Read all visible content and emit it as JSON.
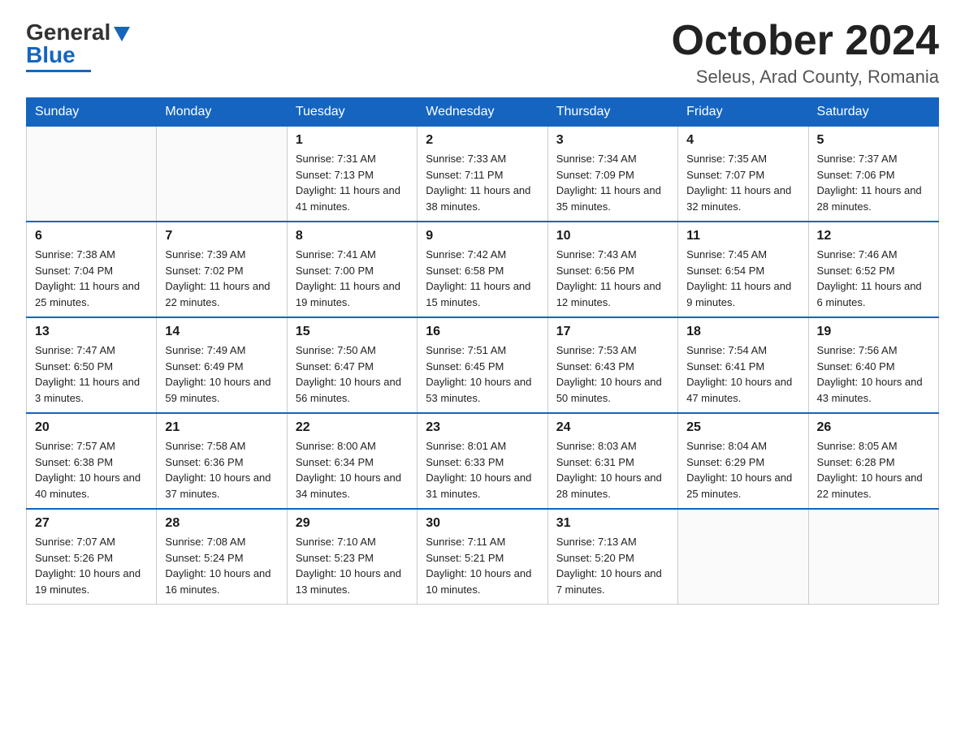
{
  "logo": {
    "general": "General",
    "blue": "Blue"
  },
  "header": {
    "month_title": "October 2024",
    "location": "Seleus, Arad County, Romania"
  },
  "weekdays": [
    "Sunday",
    "Monday",
    "Tuesday",
    "Wednesday",
    "Thursday",
    "Friday",
    "Saturday"
  ],
  "weeks": [
    [
      {
        "day": "",
        "sunrise": "",
        "sunset": "",
        "daylight": ""
      },
      {
        "day": "",
        "sunrise": "",
        "sunset": "",
        "daylight": ""
      },
      {
        "day": "1",
        "sunrise": "Sunrise: 7:31 AM",
        "sunset": "Sunset: 7:13 PM",
        "daylight": "Daylight: 11 hours and 41 minutes."
      },
      {
        "day": "2",
        "sunrise": "Sunrise: 7:33 AM",
        "sunset": "Sunset: 7:11 PM",
        "daylight": "Daylight: 11 hours and 38 minutes."
      },
      {
        "day": "3",
        "sunrise": "Sunrise: 7:34 AM",
        "sunset": "Sunset: 7:09 PM",
        "daylight": "Daylight: 11 hours and 35 minutes."
      },
      {
        "day": "4",
        "sunrise": "Sunrise: 7:35 AM",
        "sunset": "Sunset: 7:07 PM",
        "daylight": "Daylight: 11 hours and 32 minutes."
      },
      {
        "day": "5",
        "sunrise": "Sunrise: 7:37 AM",
        "sunset": "Sunset: 7:06 PM",
        "daylight": "Daylight: 11 hours and 28 minutes."
      }
    ],
    [
      {
        "day": "6",
        "sunrise": "Sunrise: 7:38 AM",
        "sunset": "Sunset: 7:04 PM",
        "daylight": "Daylight: 11 hours and 25 minutes."
      },
      {
        "day": "7",
        "sunrise": "Sunrise: 7:39 AM",
        "sunset": "Sunset: 7:02 PM",
        "daylight": "Daylight: 11 hours and 22 minutes."
      },
      {
        "day": "8",
        "sunrise": "Sunrise: 7:41 AM",
        "sunset": "Sunset: 7:00 PM",
        "daylight": "Daylight: 11 hours and 19 minutes."
      },
      {
        "day": "9",
        "sunrise": "Sunrise: 7:42 AM",
        "sunset": "Sunset: 6:58 PM",
        "daylight": "Daylight: 11 hours and 15 minutes."
      },
      {
        "day": "10",
        "sunrise": "Sunrise: 7:43 AM",
        "sunset": "Sunset: 6:56 PM",
        "daylight": "Daylight: 11 hours and 12 minutes."
      },
      {
        "day": "11",
        "sunrise": "Sunrise: 7:45 AM",
        "sunset": "Sunset: 6:54 PM",
        "daylight": "Daylight: 11 hours and 9 minutes."
      },
      {
        "day": "12",
        "sunrise": "Sunrise: 7:46 AM",
        "sunset": "Sunset: 6:52 PM",
        "daylight": "Daylight: 11 hours and 6 minutes."
      }
    ],
    [
      {
        "day": "13",
        "sunrise": "Sunrise: 7:47 AM",
        "sunset": "Sunset: 6:50 PM",
        "daylight": "Daylight: 11 hours and 3 minutes."
      },
      {
        "day": "14",
        "sunrise": "Sunrise: 7:49 AM",
        "sunset": "Sunset: 6:49 PM",
        "daylight": "Daylight: 10 hours and 59 minutes."
      },
      {
        "day": "15",
        "sunrise": "Sunrise: 7:50 AM",
        "sunset": "Sunset: 6:47 PM",
        "daylight": "Daylight: 10 hours and 56 minutes."
      },
      {
        "day": "16",
        "sunrise": "Sunrise: 7:51 AM",
        "sunset": "Sunset: 6:45 PM",
        "daylight": "Daylight: 10 hours and 53 minutes."
      },
      {
        "day": "17",
        "sunrise": "Sunrise: 7:53 AM",
        "sunset": "Sunset: 6:43 PM",
        "daylight": "Daylight: 10 hours and 50 minutes."
      },
      {
        "day": "18",
        "sunrise": "Sunrise: 7:54 AM",
        "sunset": "Sunset: 6:41 PM",
        "daylight": "Daylight: 10 hours and 47 minutes."
      },
      {
        "day": "19",
        "sunrise": "Sunrise: 7:56 AM",
        "sunset": "Sunset: 6:40 PM",
        "daylight": "Daylight: 10 hours and 43 minutes."
      }
    ],
    [
      {
        "day": "20",
        "sunrise": "Sunrise: 7:57 AM",
        "sunset": "Sunset: 6:38 PM",
        "daylight": "Daylight: 10 hours and 40 minutes."
      },
      {
        "day": "21",
        "sunrise": "Sunrise: 7:58 AM",
        "sunset": "Sunset: 6:36 PM",
        "daylight": "Daylight: 10 hours and 37 minutes."
      },
      {
        "day": "22",
        "sunrise": "Sunrise: 8:00 AM",
        "sunset": "Sunset: 6:34 PM",
        "daylight": "Daylight: 10 hours and 34 minutes."
      },
      {
        "day": "23",
        "sunrise": "Sunrise: 8:01 AM",
        "sunset": "Sunset: 6:33 PM",
        "daylight": "Daylight: 10 hours and 31 minutes."
      },
      {
        "day": "24",
        "sunrise": "Sunrise: 8:03 AM",
        "sunset": "Sunset: 6:31 PM",
        "daylight": "Daylight: 10 hours and 28 minutes."
      },
      {
        "day": "25",
        "sunrise": "Sunrise: 8:04 AM",
        "sunset": "Sunset: 6:29 PM",
        "daylight": "Daylight: 10 hours and 25 minutes."
      },
      {
        "day": "26",
        "sunrise": "Sunrise: 8:05 AM",
        "sunset": "Sunset: 6:28 PM",
        "daylight": "Daylight: 10 hours and 22 minutes."
      }
    ],
    [
      {
        "day": "27",
        "sunrise": "Sunrise: 7:07 AM",
        "sunset": "Sunset: 5:26 PM",
        "daylight": "Daylight: 10 hours and 19 minutes."
      },
      {
        "day": "28",
        "sunrise": "Sunrise: 7:08 AM",
        "sunset": "Sunset: 5:24 PM",
        "daylight": "Daylight: 10 hours and 16 minutes."
      },
      {
        "day": "29",
        "sunrise": "Sunrise: 7:10 AM",
        "sunset": "Sunset: 5:23 PM",
        "daylight": "Daylight: 10 hours and 13 minutes."
      },
      {
        "day": "30",
        "sunrise": "Sunrise: 7:11 AM",
        "sunset": "Sunset: 5:21 PM",
        "daylight": "Daylight: 10 hours and 10 minutes."
      },
      {
        "day": "31",
        "sunrise": "Sunrise: 7:13 AM",
        "sunset": "Sunset: 5:20 PM",
        "daylight": "Daylight: 10 hours and 7 minutes."
      },
      {
        "day": "",
        "sunrise": "",
        "sunset": "",
        "daylight": ""
      },
      {
        "day": "",
        "sunrise": "",
        "sunset": "",
        "daylight": ""
      }
    ]
  ]
}
